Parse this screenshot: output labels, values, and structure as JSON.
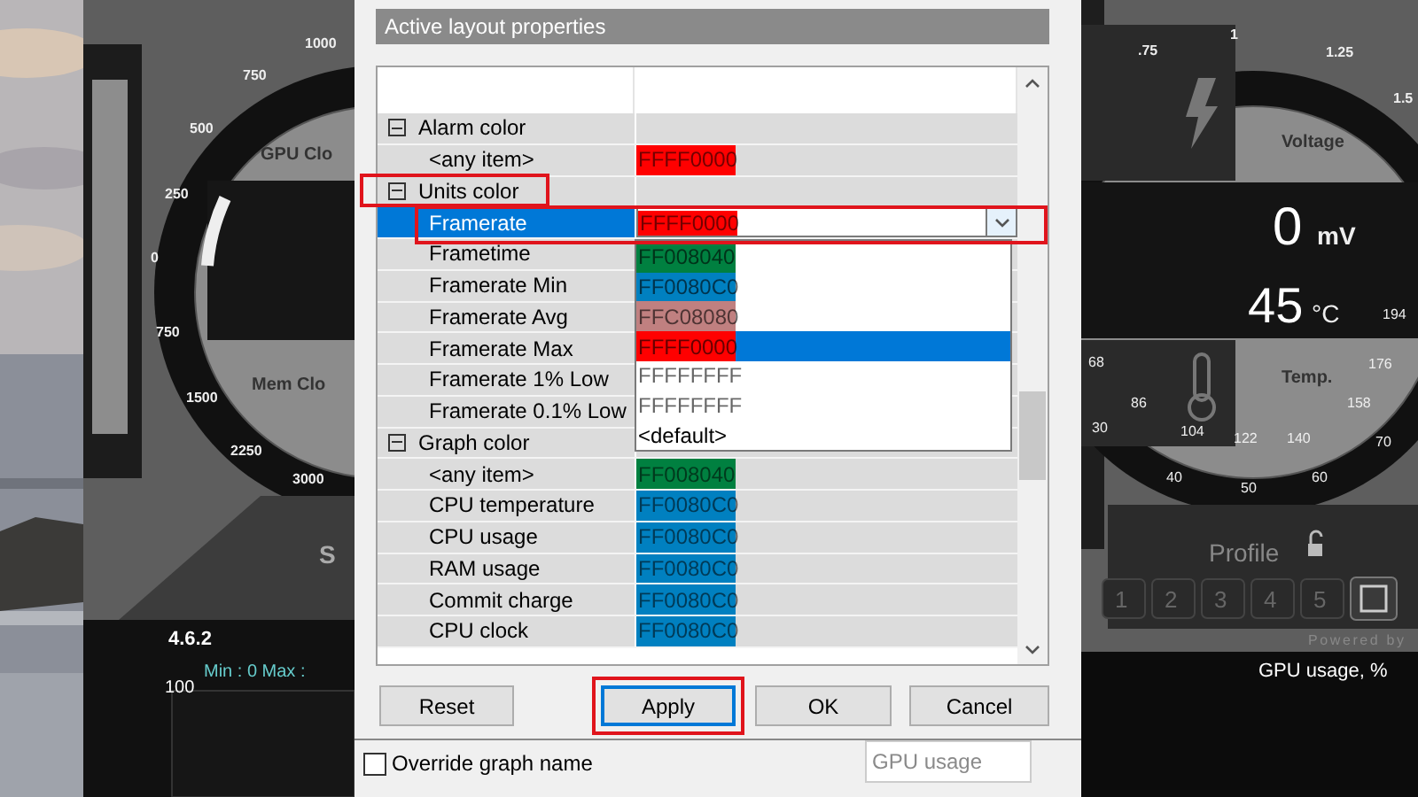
{
  "left_monitor": {
    "gauge_labels": [
      "GPU Clo",
      "Mem Clo"
    ],
    "ticks": [
      "1000",
      "750",
      "500",
      "250",
      "0",
      "750",
      "1500",
      "2250",
      "3000"
    ],
    "button_text": "S",
    "version": "4.6.2",
    "graph_max": "100",
    "graph_minmax": "Min : 0   Max :"
  },
  "dialog": {
    "title": "Active layout properties",
    "rows": [
      {
        "kind": "group",
        "label": "Alarm color",
        "expanded": true,
        "highlighted": false
      },
      {
        "kind": "item",
        "label": "<any item>",
        "value": "FFFF0000",
        "color": "#ff0000",
        "selected": false,
        "highlighted": false
      },
      {
        "kind": "group",
        "label": "Units color",
        "expanded": true,
        "highlighted": true
      },
      {
        "kind": "item",
        "label": "Framerate",
        "value": "FFFF0000",
        "color": "#ff0000",
        "selected": true,
        "highlighted": true
      },
      {
        "kind": "item",
        "label": "Frametime",
        "selected": false,
        "highlighted": false
      },
      {
        "kind": "item",
        "label": "Framerate Min",
        "selected": false,
        "highlighted": false
      },
      {
        "kind": "item",
        "label": "Framerate Avg",
        "selected": false,
        "highlighted": false
      },
      {
        "kind": "item",
        "label": "Framerate Max",
        "selected": false,
        "highlighted": false
      },
      {
        "kind": "item",
        "label": "Framerate 1% Low",
        "selected": false,
        "highlighted": false
      },
      {
        "kind": "item",
        "label": "Framerate 0.1% Low",
        "selected": false,
        "highlighted": false
      },
      {
        "kind": "group",
        "label": "Graph color",
        "expanded": true,
        "highlighted": false
      },
      {
        "kind": "item",
        "label": "<any item>",
        "value": "FF008040",
        "color": "#008040",
        "selected": false,
        "highlighted": false
      },
      {
        "kind": "item",
        "label": "CPU temperature",
        "value": "FF0080C0",
        "color": "#0080c0",
        "selected": false,
        "highlighted": false
      },
      {
        "kind": "item",
        "label": "CPU usage",
        "value": "FF0080C0",
        "color": "#0080c0",
        "selected": false,
        "highlighted": false
      },
      {
        "kind": "item",
        "label": "RAM usage",
        "value": "FF0080C0",
        "color": "#0080c0",
        "selected": false,
        "highlighted": false
      },
      {
        "kind": "item",
        "label": "Commit charge",
        "value": "FF0080C0",
        "color": "#0080c0",
        "selected": false,
        "highlighted": false
      },
      {
        "kind": "item",
        "label": "CPU clock",
        "value": "FF0080C0",
        "color": "#0080c0",
        "selected": false,
        "highlighted": false
      }
    ],
    "dropdown_options": [
      {
        "label": "FF008040",
        "color": "#008040",
        "selected": false
      },
      {
        "label": "FF0080C0",
        "color": "#0080c0",
        "selected": false
      },
      {
        "label": "FFC08080",
        "color": "#c08080",
        "selected": false
      },
      {
        "label": "FFFF0000",
        "color": "#ff0000",
        "selected": true
      },
      {
        "label": "FFFFFFFF",
        "color": "#ffffff",
        "selected": false
      },
      {
        "label": "FFFFFFFF",
        "color": "#ffffff",
        "selected": false
      },
      {
        "label": "<default>",
        "selected": false
      }
    ],
    "buttons": [
      {
        "label": "Reset",
        "focused": false,
        "highlighted": false
      },
      {
        "label": "Apply",
        "focused": true,
        "highlighted": true
      },
      {
        "label": "OK",
        "focused": false,
        "highlighted": false
      },
      {
        "label": "Cancel",
        "focused": false,
        "highlighted": false
      }
    ]
  },
  "below": {
    "override_checkbox": {
      "label": "Override graph name",
      "checked": false
    },
    "graph_name_field": {
      "value": "GPU usage",
      "disabled": true
    }
  },
  "right_monitor": {
    "voltage_ticks": [
      ".75",
      "1",
      "1.25",
      "1.5"
    ],
    "voltage_label": "Voltage",
    "voltage_value": "0",
    "voltage_unit": "mV",
    "temp_value": "45",
    "temp_unit": "°C",
    "temp_ticks": [
      "194",
      "68",
      "176",
      "86",
      "158",
      "30",
      "104",
      "122",
      "140",
      "70",
      "40",
      "60",
      "50"
    ],
    "temp_label": "Temp.",
    "profile_label": "Profile",
    "profile_slots": [
      "1",
      "2",
      "3",
      "4",
      "5"
    ],
    "powered_by": "Powered by",
    "graph_title": "GPU usage, %"
  }
}
